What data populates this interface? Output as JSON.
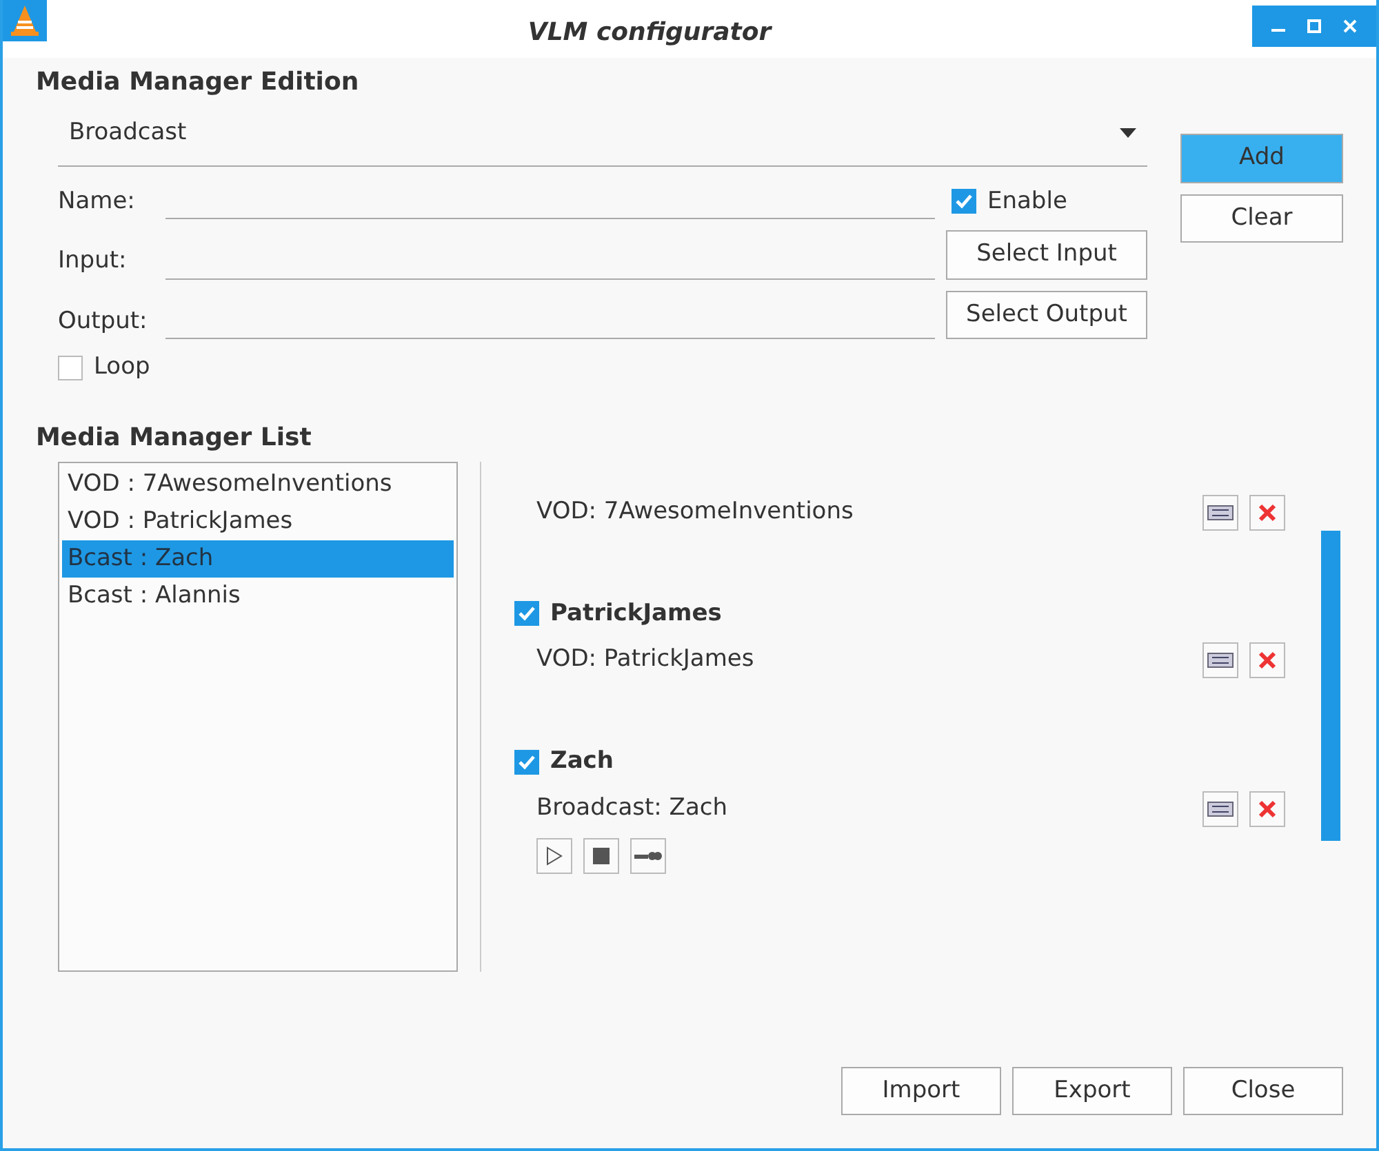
{
  "window": {
    "title": "VLM configurator"
  },
  "edition": {
    "heading": "Media Manager Edition",
    "type_value": "Broadcast",
    "name_label": "Name:",
    "input_label": "Input:",
    "output_label": "Output:",
    "enable": {
      "label": "Enable",
      "checked": true
    },
    "loop": {
      "label": "Loop",
      "checked": false
    },
    "select_input": "Select Input",
    "select_output": "Select Output",
    "add": "Add",
    "clear": "Clear"
  },
  "list": {
    "heading": "Media Manager List",
    "items": [
      {
        "label": "VOD : 7AwesomeInventions",
        "selected": false
      },
      {
        "label": "VOD : PatrickJames",
        "selected": false
      },
      {
        "label": "Bcast : Zach",
        "selected": true
      },
      {
        "label": "Bcast : Alannis",
        "selected": false
      }
    ]
  },
  "entries": [
    {
      "kind": "vod",
      "description": "VOD: 7AwesomeInventions"
    },
    {
      "kind": "vod",
      "name": "PatrickJames",
      "checked": true,
      "description": "VOD: PatrickJames"
    },
    {
      "kind": "broadcast",
      "name": "Zach",
      "checked": true,
      "description": "Broadcast: Zach"
    }
  ],
  "buttons": [
    "Import",
    "Export",
    "Close"
  ]
}
